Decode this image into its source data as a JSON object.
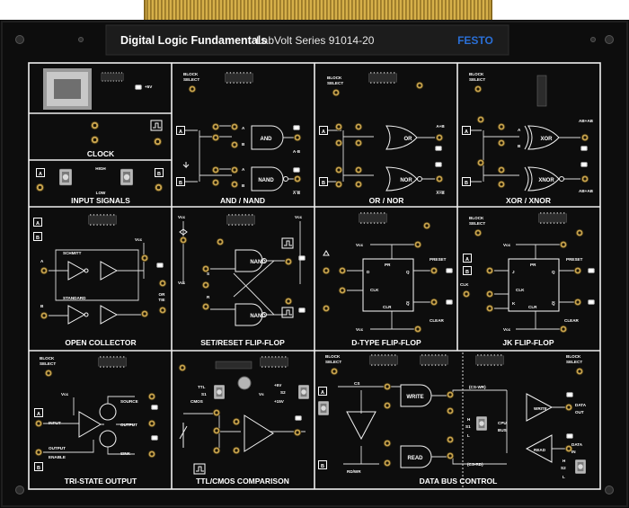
{
  "header": {
    "title": "Digital Logic Fundamentals",
    "series": "LabVolt Series 91014-20",
    "brand": "FESTO"
  },
  "sections": {
    "clock": "CLOCK",
    "input_signals": "INPUT SIGNALS",
    "and_nand": "AND / NAND",
    "or_nor": "OR / NOR",
    "xor_xnor": "XOR / XNOR",
    "open_collector": "OPEN COLLECTOR",
    "set_reset": "SET/RESET FLIP-FLOP",
    "d_type": "D-TYPE FLIP-FLOP",
    "jk": "JK FLIP-FLOP",
    "tri_state": "TRI-STATE OUTPUT",
    "ttl_cmos": "TTL/CMOS COMPARISON",
    "data_bus": "DATA BUS CONTROL"
  },
  "labels": {
    "plus5v": "+5V",
    "high": "HIGH",
    "low": "LOW",
    "A": "A",
    "B": "B",
    "block": "BLOCK",
    "select": "SELECT",
    "and": "AND",
    "nand": "NAND",
    "or": "OR",
    "nor": "NOR",
    "xor": "XOR",
    "xnor": "XNOR",
    "a_dot_b": "A·B",
    "a_dot_b_bar": "A·B",
    "a_plus_b": "A+B",
    "a_plus_b_bar": "A+B",
    "ab_plus_ab": "AB+AB",
    "vcc": "Vcc",
    "schmitt": "SCHMITT",
    "standard": "STANDARD",
    "or_tie_1": "OR",
    "or_tie_2": "TIE",
    "s": "S",
    "r": "R",
    "pr": "PR",
    "preset": "PRESET",
    "d": "D",
    "q": "Q",
    "clk": "CLK",
    "clr": "CLR",
    "clear": "CLEAR",
    "j": "J",
    "k": "K",
    "input": "INPUT",
    "output": "OUTPUT",
    "enable": "ENABLE",
    "source": "SOURCE",
    "sink": "SINK",
    "ttl": "TTL",
    "cmos": "CMOS",
    "s1": "S1",
    "s2": "S2",
    "vs": "Vs",
    "plus15v": "+15V",
    "cs": "CS",
    "write": "WRITE",
    "read": "READ",
    "rd_wr": "RD/WR",
    "cs_wr": "(CS-WR)",
    "cs_rd": "(CS-RD)",
    "cpu_bus_1": "CPU",
    "cpu_bus_2": "BUS",
    "h": "H",
    "l": "L",
    "data_out_1": "DATA",
    "data_out_2": "OUT",
    "data_in_1": "DATA",
    "data_in_2": "IN"
  },
  "colors": {
    "board": "#0d0d0d",
    "panel_edge": "#1f1f1f",
    "connector_gold": "#c9a33f",
    "jack_brass": "#c9a44e",
    "label_plate": "#1c1c1c",
    "brand_blue": "#2a6fd6",
    "led_white": "#e8e8e8",
    "chip": "#2a2a2a"
  }
}
